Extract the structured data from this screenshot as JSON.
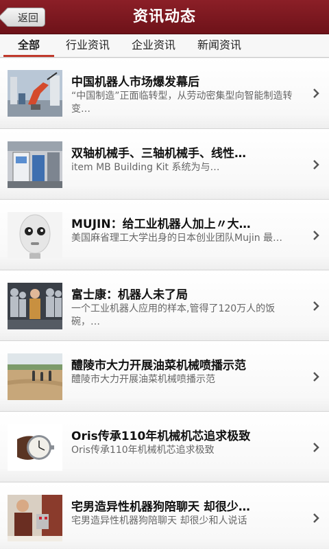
{
  "header": {
    "back_label": "返回",
    "title": "资讯动态"
  },
  "tabs": [
    {
      "label": "全部",
      "active": true
    },
    {
      "label": "行业资讯",
      "active": false
    },
    {
      "label": "企业资讯",
      "active": false
    },
    {
      "label": "新闻资讯",
      "active": false
    }
  ],
  "articles": [
    {
      "title": "中国机器人市场爆发幕后",
      "summary": "“中国制造”正面临转型，从劳动密集型向智能制造转变…",
      "thumb_icon": "factory-robot-arm-photo"
    },
    {
      "title": "双轴机械手、三轴机械手、线性…",
      "summary": "item MB Building Kit 系统为与…",
      "thumb_icon": "industrial-machine-photo"
    },
    {
      "title": "MUJIN：给工业机器人加上〃大…",
      "summary": "美国麻省理工大学出身的日本创业团队Mujin 最…",
      "thumb_icon": "robot-face-photo"
    },
    {
      "title": "富士康：机器人未了局",
      "summary": "一个工业机器人应用的样本,管得了120万人的饭碗，…",
      "thumb_icon": "humanoid-robots-photo"
    },
    {
      "title": "醴陵市大力开展油菜机械喷播示范",
      "summary": "醴陵市大力开展油菜机械喷播示范",
      "thumb_icon": "field-workers-photo"
    },
    {
      "title": "Oris传承110年机械机芯追求极致",
      "summary": "Oris传承110年机械机芯追求极致",
      "thumb_icon": "wristwatch-photo"
    },
    {
      "title": "宅男造异性机器狗陪聊天 却很少…",
      "summary": "宅男造异性机器狗陪聊天 却很少和人说话",
      "thumb_icon": "man-with-robot-photo"
    }
  ]
}
